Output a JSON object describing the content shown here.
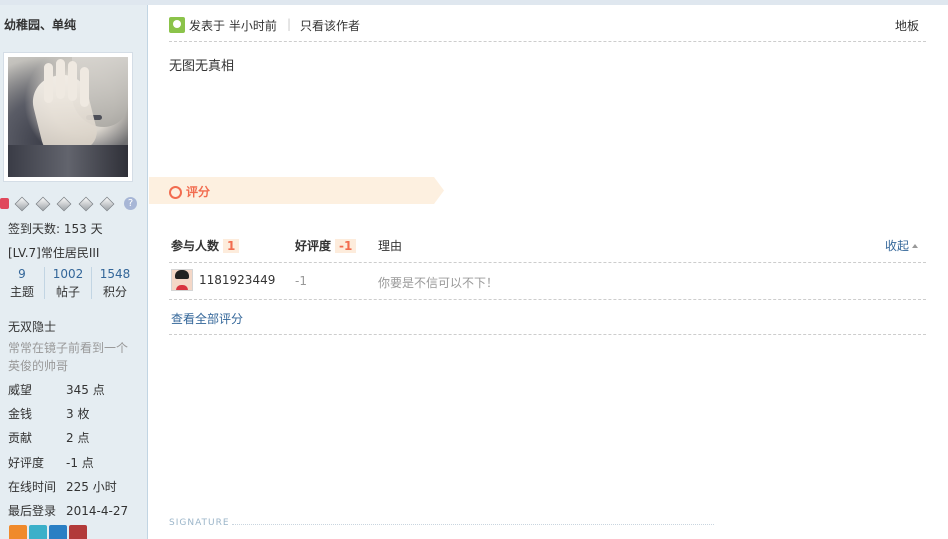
{
  "sidebar": {
    "username": "幼稚园、单纯",
    "checkin": "签到天数: 153 天",
    "level": "[LV.7]常住居民III",
    "stats": [
      {
        "value": "9",
        "label": "主题"
      },
      {
        "value": "1002",
        "label": "帖子"
      },
      {
        "value": "1548",
        "label": "积分"
      }
    ],
    "title": "无双隐士",
    "motto": "常常在镜子前看到一个英俊的帅哥",
    "info": [
      {
        "key": "威望",
        "value": "345 点"
      },
      {
        "key": "金钱",
        "value": "3 枚"
      },
      {
        "key": "贡献",
        "value": "2 点"
      },
      {
        "key": "好评度",
        "value": "-1 点"
      },
      {
        "key": "在线时间",
        "value": "225 小时"
      },
      {
        "key": "最后登录",
        "value": "2014-4-27"
      }
    ],
    "help_badge": "?"
  },
  "post": {
    "posted_at": "发表于 半小时前",
    "separator": "|",
    "only_author": "只看该作者",
    "floor": "地板",
    "content": "无图无真相"
  },
  "rating": {
    "title": "评分",
    "participants_label": "参与人数",
    "participants_count": "1",
    "score_label": "好评度",
    "score_total": "-1",
    "reason_label": "理由",
    "collapse_label": "收起",
    "rows": [
      {
        "user": "1181923449",
        "score": "-1",
        "reason": "你要是不信可以不下！"
      }
    ],
    "view_all": "查看全部评分"
  },
  "signature": {
    "label": "SIGNATURE"
  },
  "colors": {
    "sidebar_bg": "#e5edf2",
    "link": "#336699",
    "accent": "#f26c4f",
    "banner_bg": "#fdf0e0"
  }
}
